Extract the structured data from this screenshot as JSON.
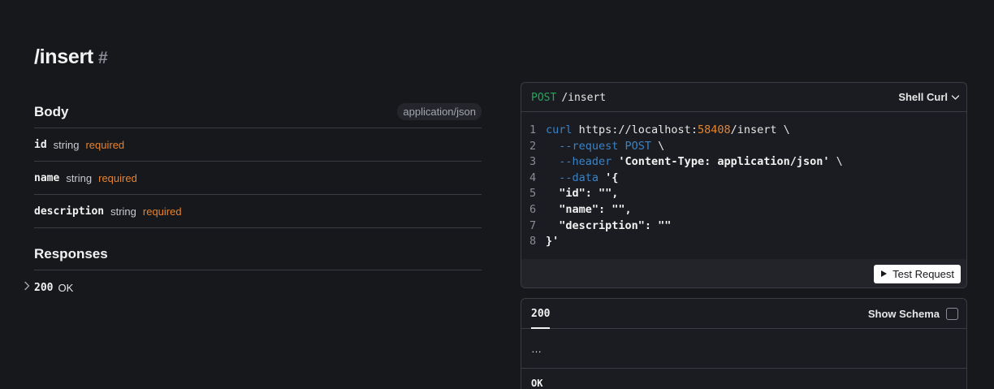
{
  "endpoint": {
    "title": "/insert",
    "anchor": "#"
  },
  "body": {
    "heading": "Body",
    "content_type": "application/json",
    "params": [
      {
        "name": "id",
        "type": "string",
        "required": "required"
      },
      {
        "name": "name",
        "type": "string",
        "required": "required"
      },
      {
        "name": "description",
        "type": "string",
        "required": "required"
      }
    ]
  },
  "responses": {
    "heading": "Responses",
    "items": [
      {
        "code": "200",
        "description": "OK"
      }
    ]
  },
  "request_card": {
    "method": "POST",
    "path": "/insert",
    "client": "Shell Curl",
    "line_numbers": [
      "1",
      "2",
      "3",
      "4",
      "5",
      "6",
      "7",
      "8"
    ],
    "code": {
      "l1_cmd": "curl",
      "l1_url_a": " https://localhost:",
      "l1_port": "58408",
      "l1_url_b": "/insert \\",
      "l2_flag": "  --request",
      "l2_val": " POST",
      "l2_end": " \\",
      "l3_flag": "  --header",
      "l3_val": " 'Content-Type: application/json'",
      "l3_end": " \\",
      "l4_flag": "  --data",
      "l4_val": " '{",
      "l5": "  \"id\": \"\",",
      "l6": "  \"name\": \"\",",
      "l7": "  \"description\": \"\"",
      "l8": "}'"
    },
    "test_button": "Test Request"
  },
  "response_card": {
    "tab": "200",
    "show_schema": "Show Schema",
    "body_preview": "…",
    "status": "OK"
  },
  "colors": {
    "background": "#17181c",
    "method_post": "#22a85a",
    "required": "#e8832c",
    "code_keyword": "#3b82c4"
  }
}
